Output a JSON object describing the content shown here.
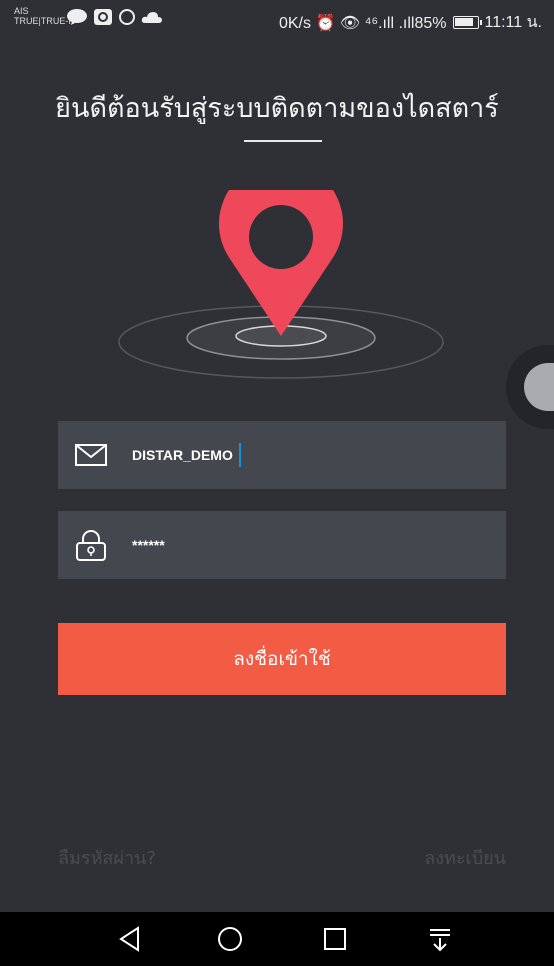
{
  "status_bar": {
    "carrier_line1": "AIS",
    "carrier_line2": "TRUE|TRUE-H",
    "right_text": "0K/s ⏰ 👁 ⁴⁶.ıll  .ıll85%",
    "time": "11:11 น."
  },
  "title": "ยินดีต้อนรับสู่ระบบติดตามของไดสตาร์",
  "form": {
    "username_value": "DISTAR_DEMO",
    "password_value": "******",
    "login_label": "ลงชื่อเข้าใช้"
  },
  "links": {
    "forgot": "ลืมรหัสผ่าน?",
    "register": "ลงทะเบียน"
  },
  "icons": {
    "username": "envelope-icon",
    "password": "lock-icon",
    "hero": "location-pin-icon"
  },
  "colors": {
    "background": "#2e3035",
    "field": "#45474e",
    "accent": "#f25b44",
    "pin": "#f0485b",
    "caret": "#1a8fd6"
  }
}
